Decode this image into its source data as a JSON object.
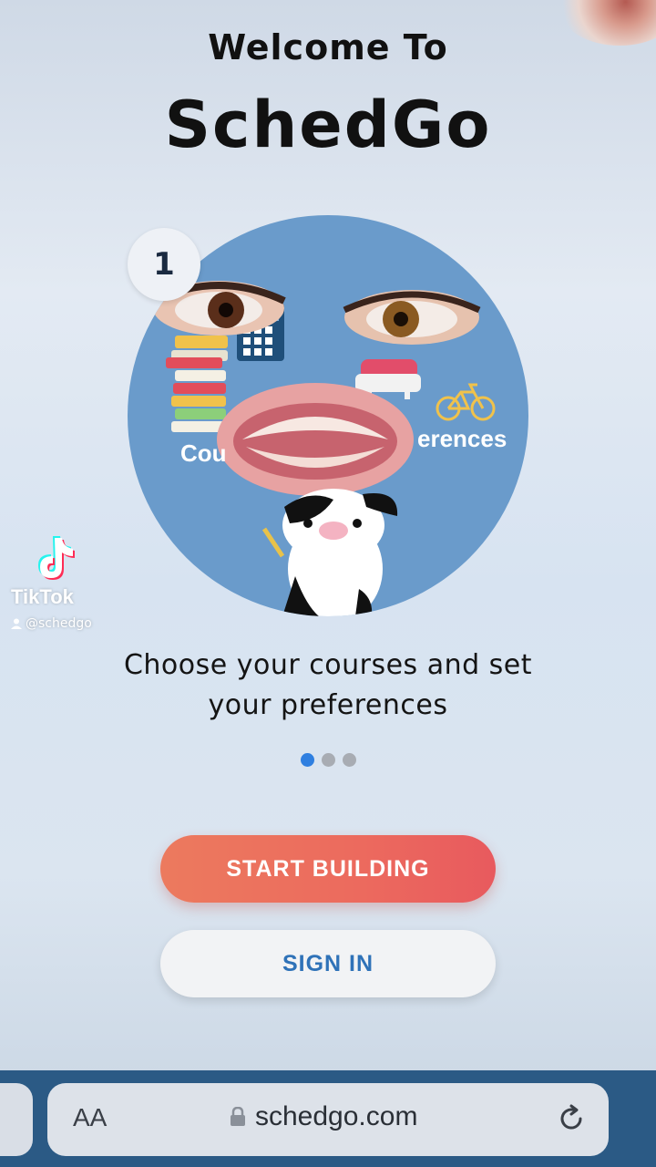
{
  "header": {
    "welcome": "Welcome To",
    "brand": "SchedGo"
  },
  "onboarding": {
    "step_number": "1",
    "illustration_label_left": "Cou",
    "illustration_label_right": "erences",
    "caption_line1": "Choose your courses and set",
    "caption_line2": "your preferences",
    "page_indicator": {
      "total": 3,
      "active": 1
    }
  },
  "actions": {
    "primary_label": "START BUILDING",
    "secondary_label": "SIGN IN"
  },
  "watermark": {
    "name": "TikTok",
    "handle": "@schedgo"
  },
  "browser": {
    "text_size_label": "AA",
    "url": "schedgo.com",
    "icons": [
      "lock-icon",
      "reload-icon"
    ]
  },
  "colors": {
    "accent_blue": "#2f7fe0",
    "primary_button": "#ec6a5e",
    "secondary_text": "#2f72b8",
    "illustration_bg": "#6a9bcb",
    "browser_bar": "#2b5a85"
  }
}
